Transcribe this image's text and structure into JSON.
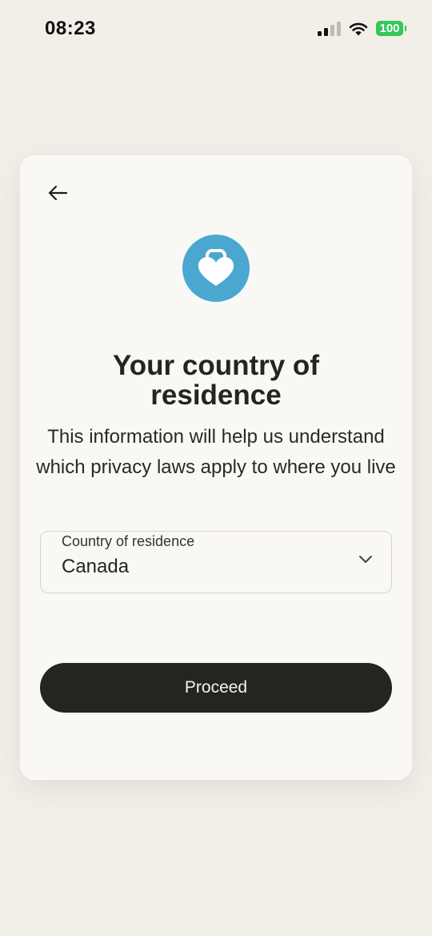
{
  "status_bar": {
    "time": "08:23",
    "battery": "100",
    "signal_icon": "cellular-signal-icon",
    "wifi_icon": "wifi-icon",
    "battery_color": "#34c759"
  },
  "card": {
    "back_icon": "arrow-left-icon",
    "badge_icon": "heart-lock-icon",
    "badge_color": "#4aa8d0",
    "title": "Your country of residence",
    "subtitle": "This information will help us understand which privacy laws apply to where you live",
    "country_field": {
      "label": "Country of residence",
      "value": "Canada",
      "dropdown_icon": "chevron-down-icon"
    },
    "proceed_label": "Proceed"
  },
  "colors": {
    "background": "#f2efe9",
    "card": "#faf8f5",
    "button": "#252420",
    "text": "#252420"
  }
}
